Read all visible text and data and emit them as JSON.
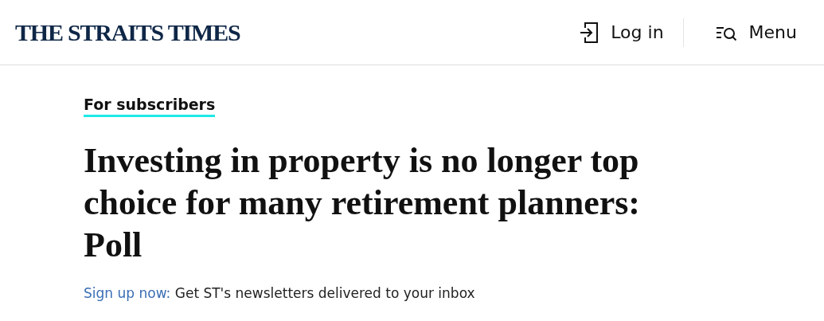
{
  "header": {
    "logo": "THE STRAITS TIMES",
    "login": "Log in",
    "menu": "Menu"
  },
  "article": {
    "label": "For subscribers",
    "headline": "Investing in property is no longer top choice for many retirement planners: Poll"
  },
  "promo": {
    "link": "Sign up now:",
    "text": "Get ST's newsletters delivered to your inbox"
  }
}
